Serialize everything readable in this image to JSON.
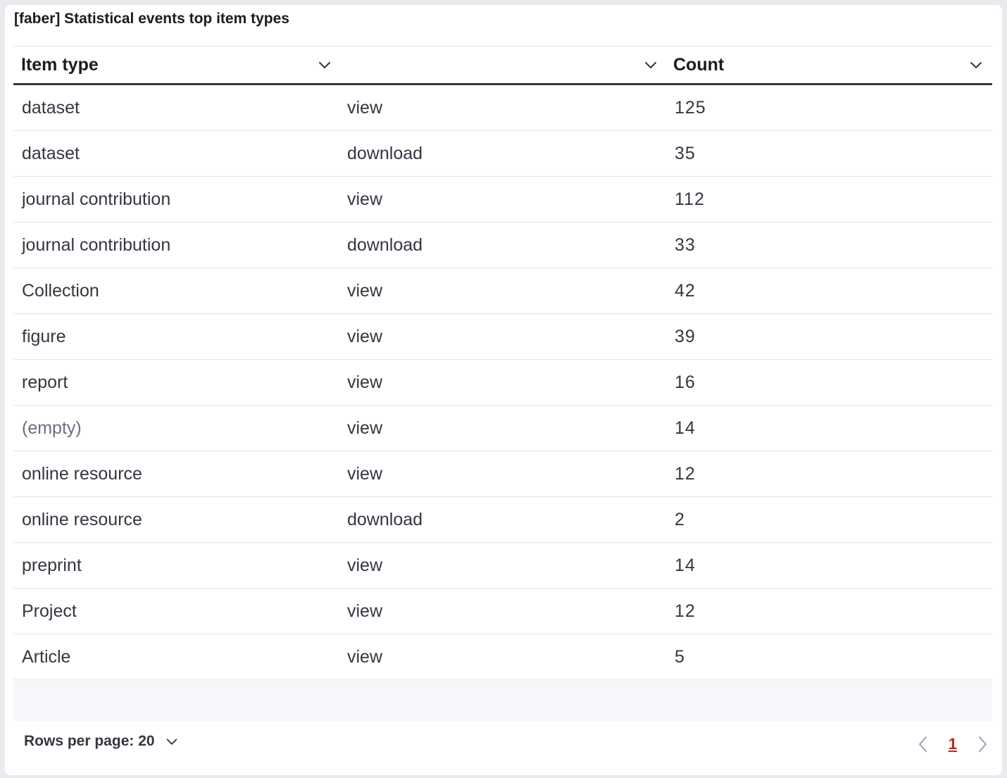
{
  "panel": {
    "title": "[faber] Statistical events top item types"
  },
  "table": {
    "columns": [
      {
        "label": "Item type",
        "menu_icon": "chevron-down-icon"
      },
      {
        "label": "",
        "menu_icon": "chevron-down-icon"
      },
      {
        "label": "Count",
        "menu_icon": "chevron-down-icon"
      }
    ],
    "rows": [
      {
        "item_type": "dataset",
        "event": "view",
        "count": "125"
      },
      {
        "item_type": "dataset",
        "event": "download",
        "count": "35"
      },
      {
        "item_type": "journal contribution",
        "event": "view",
        "count": "112"
      },
      {
        "item_type": "journal contribution",
        "event": "download",
        "count": "33"
      },
      {
        "item_type": "Collection",
        "event": "view",
        "count": "42"
      },
      {
        "item_type": "figure",
        "event": "view",
        "count": "39"
      },
      {
        "item_type": "report",
        "event": "view",
        "count": "16"
      },
      {
        "item_type": "(empty)",
        "event": "view",
        "count": "14"
      },
      {
        "item_type": "online resource",
        "event": "view",
        "count": "12"
      },
      {
        "item_type": "online resource",
        "event": "download",
        "count": "2"
      },
      {
        "item_type": "preprint",
        "event": "view",
        "count": "14"
      },
      {
        "item_type": "Project",
        "event": "view",
        "count": "12"
      },
      {
        "item_type": "Article",
        "event": "view",
        "count": "5"
      }
    ]
  },
  "footer": {
    "rows_per_page_label": "Rows per page: 20",
    "current_page": "1",
    "prev_icon": "chevron-left-icon",
    "next_icon": "chevron-right-icon"
  },
  "colors": {
    "header_border": "#343741",
    "row_border": "#e3e6ec",
    "empty_text": "#69707d",
    "active_page": "#bd271e",
    "background": "#e9eaed"
  }
}
